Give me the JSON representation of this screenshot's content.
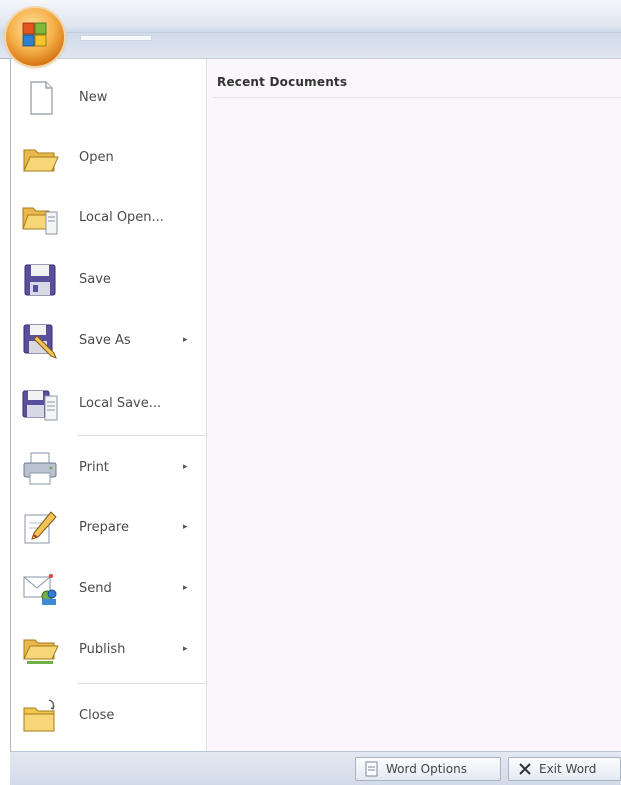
{
  "window": {
    "accent": "#dfe6f0",
    "office_button_icon": "office-logo-icon"
  },
  "menu": {
    "items": [
      {
        "label": "New",
        "icon": "new-document-icon",
        "submenu": false
      },
      {
        "label": "Open",
        "icon": "open-folder-icon",
        "submenu": false
      },
      {
        "label": "Local Open...",
        "icon": "local-open-icon",
        "submenu": false
      },
      {
        "label": "Save",
        "icon": "floppy-save-icon",
        "submenu": false
      },
      {
        "label": "Save As",
        "icon": "save-as-icon",
        "submenu": true
      },
      {
        "label": "Local Save...",
        "icon": "local-save-icon",
        "submenu": false
      },
      {
        "label": "Print",
        "icon": "printer-icon",
        "submenu": true
      },
      {
        "label": "Prepare",
        "icon": "prepare-pencil-icon",
        "submenu": true
      },
      {
        "label": "Send",
        "icon": "send-mail-icon",
        "submenu": true
      },
      {
        "label": "Publish",
        "icon": "publish-folder-icon",
        "submenu": true
      },
      {
        "label": "Close",
        "icon": "close-folder-icon",
        "submenu": false
      }
    ],
    "submenu_arrow": "▸"
  },
  "recent": {
    "title": "Recent Documents",
    "documents": []
  },
  "footer": {
    "options_label": "Word Options",
    "exit_label": "Exit Word"
  }
}
